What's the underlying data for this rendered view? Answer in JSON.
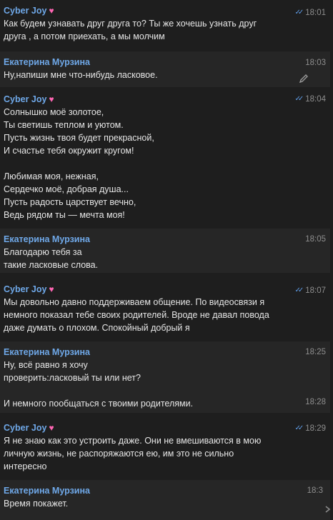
{
  "messages": [
    {
      "sender": "Cyber Joy",
      "heart": true,
      "time": "18:01",
      "read": true,
      "lines": [
        "Как будем узнавать друг друга то? Ты же хочешь узнать друг",
        "друга , а потом приехать, а мы молчим"
      ]
    },
    {
      "sender": "Екатерина Мурзина",
      "time": "18:03",
      "lines": [
        "Ну,напиши мне что-нибудь ласковое."
      ]
    },
    {
      "sender": "Cyber Joy",
      "heart": true,
      "time": "18:04",
      "read": true,
      "lines": [
        "Солнышко моё золотое,",
        "Ты светишь теплом и уютом.",
        "Пусть жизнь твоя будет прекрасной,",
        "И счастье тебя окружит кругом!",
        "",
        "Любимая моя, нежная,",
        "Сердечко моё, добрая душа...",
        "Пусть радость царствует вечно,",
        "Ведь рядом ты — мечта моя!"
      ]
    },
    {
      "sender": "Екатерина Мурзина",
      "time": "18:05",
      "lines": [
        "Благодарю тебя за",
        "такие ласковые слова."
      ]
    },
    {
      "sender": "Cyber Joy",
      "heart": true,
      "time": "18:07",
      "read": true,
      "lines": [
        "Мы довольно давно поддерживаем общение. По видеосвязи я",
        "немного показал тебе своих родителей. Вроде не давал повода",
        "даже думать о плохом. Спокойный добрый я"
      ]
    },
    {
      "sender": "Екатерина Мурзина",
      "time": "18:25",
      "lines": [
        "Ну, всё равно я хочу",
        "проверить:ласковый ты или нет?"
      ]
    },
    {
      "time": "18:28",
      "lines": [
        "И немного пообщаться с твоими родителями."
      ]
    },
    {
      "sender": "Cyber Joy",
      "heart": true,
      "time": "18:29",
      "read": true,
      "lines": [
        "Я не знаю как это устроить даже. Они не вмешиваются в мою",
        "личную жизнь, не распоряжаются ею, им это не сильно",
        "интересно"
      ]
    },
    {
      "sender": "Екатерина Мурзина",
      "time": "18:3",
      "lines": [
        "Время покажет."
      ]
    }
  ]
}
